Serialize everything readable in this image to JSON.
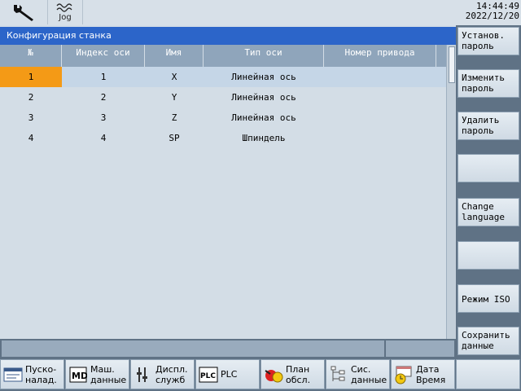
{
  "header": {
    "mode_icons": [
      {
        "name": "wrench-icon"
      },
      {
        "name": "jog-mode-icon",
        "label": "Jog"
      }
    ],
    "time": "14:44:49",
    "date": "2022/12/20"
  },
  "panel": {
    "title": "Конфигурация станка",
    "columns": [
      "№",
      "Индекс оси",
      "Имя",
      "Тип оси",
      "Номер привода"
    ],
    "rows": [
      {
        "num": "1",
        "index": "1",
        "name": "X",
        "type": "Линейная ось",
        "drive": ""
      },
      {
        "num": "2",
        "index": "2",
        "name": "Y",
        "type": "Линейная ось",
        "drive": ""
      },
      {
        "num": "3",
        "index": "3",
        "name": "Z",
        "type": "Линейная ось",
        "drive": ""
      },
      {
        "num": "4",
        "index": "4",
        "name": "SP",
        "type": "Шпиндель",
        "drive": ""
      }
    ],
    "selected_row": 1
  },
  "right_softkeys": [
    "Установ.\nпароль",
    "Изменить\nпароль",
    "Удалить\nпароль",
    "",
    "Change\nlanguage",
    "",
    "Режим ISO",
    "Сохранить\nданные"
  ],
  "bottom_softkeys": [
    {
      "label": "Пуско-\nналад.",
      "icon": "startup-icon"
    },
    {
      "label": "Маш.\nданные",
      "icon": "machine-data-icon"
    },
    {
      "label": "Диспл.\nслужб",
      "icon": "service-display-icon"
    },
    {
      "label": "PLC",
      "icon": "plc-icon"
    },
    {
      "label": "План\nобсл.",
      "icon": "maintenance-plan-icon"
    },
    {
      "label": "Сис.\nданные",
      "icon": "system-data-icon"
    },
    {
      "label": "Дата\nВремя",
      "icon": "date-time-icon"
    },
    {
      "label": "",
      "icon": ""
    }
  ],
  "colors": {
    "title_bar": "#2c65c9",
    "header_row": "#8fa5bb",
    "selection": "#f49a16",
    "background": "#d3dde6",
    "frame": "#5f7285"
  }
}
